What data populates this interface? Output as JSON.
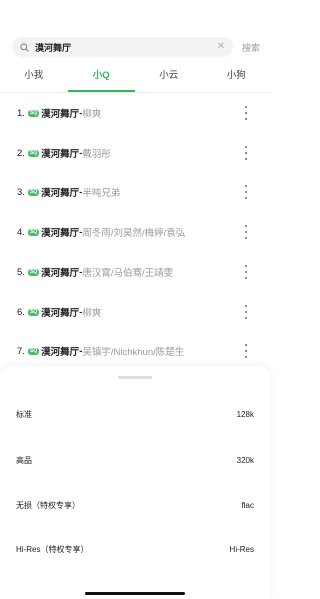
{
  "search": {
    "query": "漠河舞厅",
    "button_label": "搜索"
  },
  "tabs": [
    {
      "label": "小我",
      "active": false
    },
    {
      "label": "小Q",
      "active": true
    },
    {
      "label": "小云",
      "active": false
    },
    {
      "label": "小狗",
      "active": false
    }
  ],
  "songs": [
    {
      "index": "1.",
      "badge": "SQ",
      "title": "漠河舞厅",
      "separator": "-",
      "artist": "柳爽"
    },
    {
      "index": "2.",
      "badge": "SQ",
      "title": "漠河舞厅",
      "separator": "-",
      "artist": "戴羽彤"
    },
    {
      "index": "3.",
      "badge": "SQ",
      "title": "漠河舞厅",
      "separator": "-",
      "artist": "半吨兄弟"
    },
    {
      "index": "4.",
      "badge": "SQ",
      "title": "漠河舞厅",
      "separator": "-",
      "artist": "周冬雨/刘昊然/梅婷/袁弘"
    },
    {
      "index": "5.",
      "badge": "SQ",
      "title": "漠河舞厅",
      "separator": "-",
      "artist": "唐汉霄/马伯骞/王靖雯"
    },
    {
      "index": "6.",
      "badge": "SQ",
      "title": "漠河舞厅",
      "separator": "-",
      "artist": "柳爽"
    },
    {
      "index": "7.",
      "badge": "SQ",
      "title": "漠河舞厅",
      "separator": "-",
      "artist": "吴镇宇/Nichkhun/陈楚生"
    }
  ],
  "quality_options": [
    {
      "label": "标准",
      "value": "128k"
    },
    {
      "label": "高品",
      "value": "320k"
    },
    {
      "label": "无损（特权专享）",
      "value": "flac"
    },
    {
      "label": "Hi-Res（特权专享）",
      "value": "Hi-Res"
    }
  ],
  "colors": {
    "accent": "#2eb85c",
    "badge": "#4dbb6a"
  }
}
